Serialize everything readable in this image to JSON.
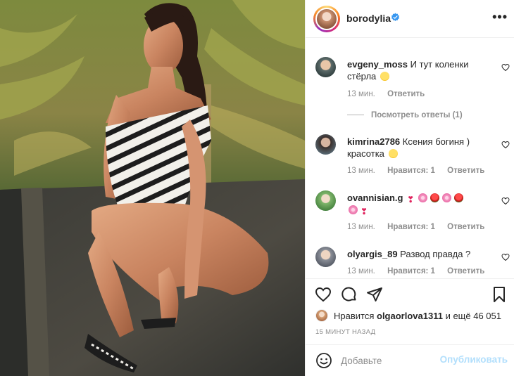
{
  "post": {
    "username": "borodylia",
    "verified": true
  },
  "header": {
    "more_label": "•••"
  },
  "comments": [
    {
      "username": "evgeny_moss",
      "text": "И тут коленки стёрла",
      "emoji": [
        "laughing-face"
      ],
      "time": "13 мин.",
      "likes": "",
      "reply_label": "Ответить",
      "view_replies": "Посмотреть ответы (1)"
    },
    {
      "username": "kimrina2786",
      "text": "Ксения богиня ) красотка",
      "emoji": [
        "heart-eyes-face"
      ],
      "time": "13 мин.",
      "likes": "Нравится: 1",
      "reply_label": "Ответить"
    },
    {
      "username": "ovannisian.g",
      "text": "",
      "emoji": [
        "heart-exclamation",
        "cherry-blossom",
        "rose",
        "cherry-blossom",
        "rose",
        "cherry-blossom",
        "heart-exclamation"
      ],
      "time": "13 мин.",
      "likes": "Нравится: 1",
      "reply_label": "Ответить"
    },
    {
      "username": "olyargis_89",
      "text": "Развод правда ?",
      "emoji": [],
      "time": "13 мин.",
      "likes": "Нравится: 1",
      "reply_label": "Ответить"
    }
  ],
  "likes": {
    "prefix": "Нравится",
    "user": "olgaorlova1311",
    "suffix": "и ещё 46 051"
  },
  "timestamp": "15 МИНУТ НАЗАД",
  "add_comment": {
    "placeholder": "Добавьте",
    "publish_label": "Опубликовать"
  },
  "colors": {
    "accent": "#0095f6",
    "publish_disabled": "#b2dffc",
    "muted": "#8e8e8e",
    "text": "#262626"
  }
}
